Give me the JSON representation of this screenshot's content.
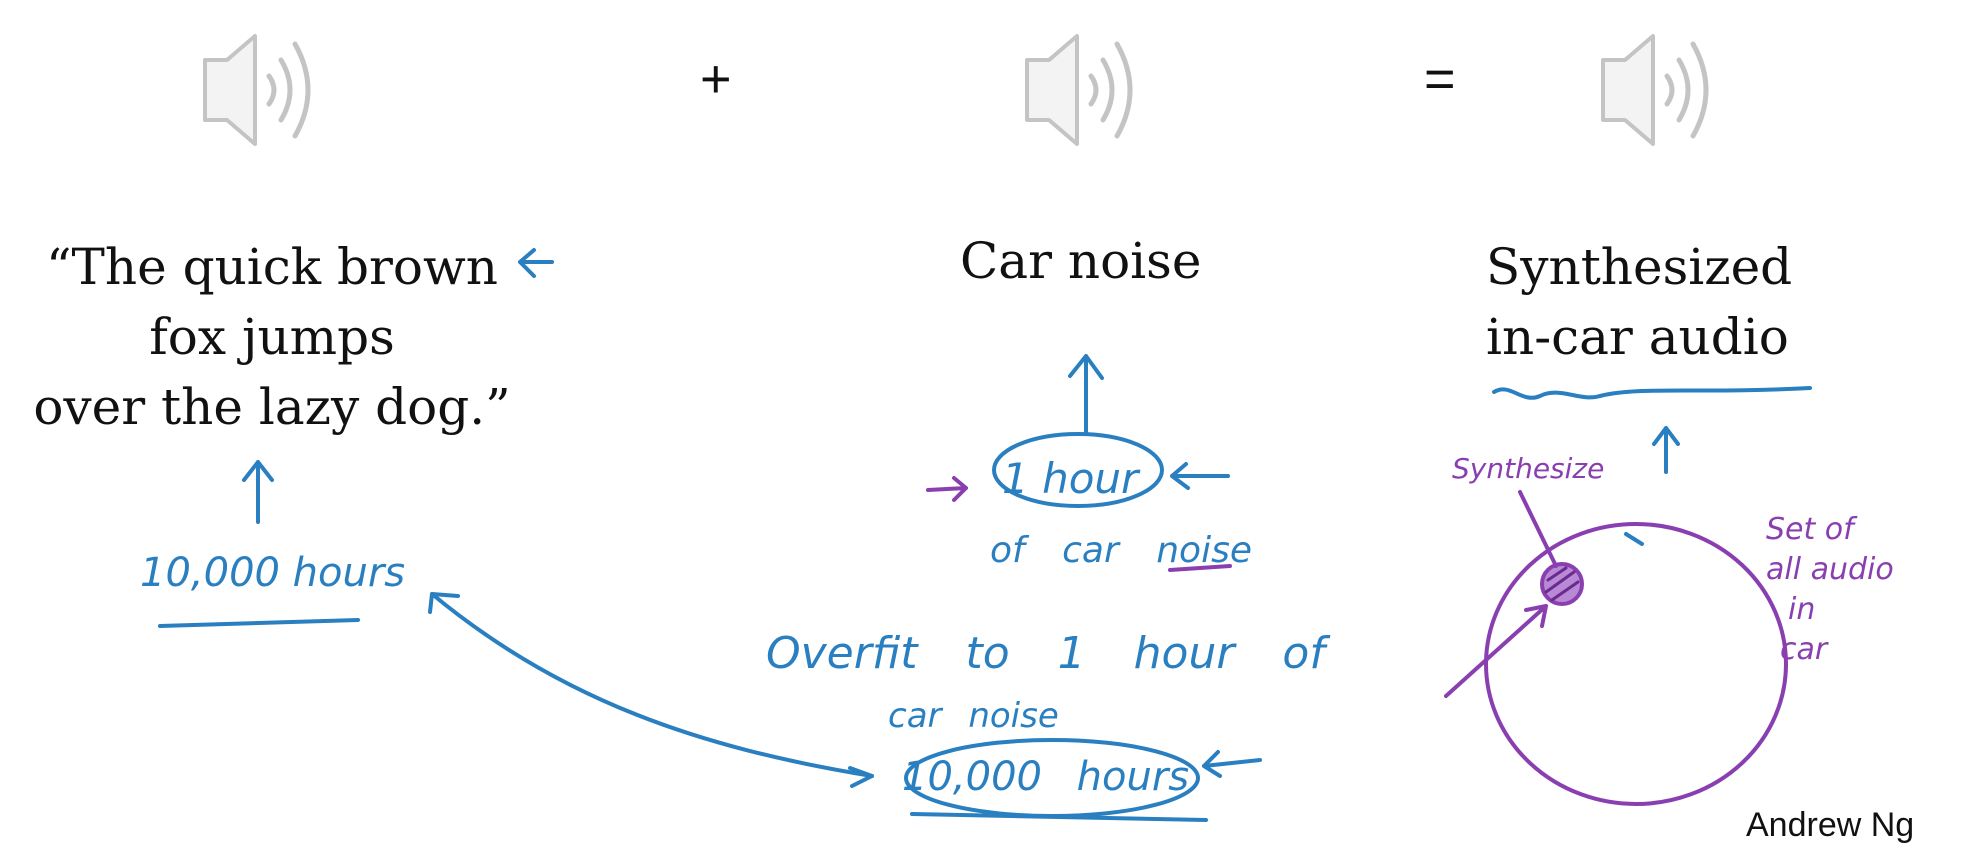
{
  "equation": {
    "plus": "+",
    "equals": "="
  },
  "left": {
    "quote_lines": [
      "“The quick brown",
      "fox jumps",
      "over the lazy dog.”"
    ],
    "hours_note": "10,000 hours"
  },
  "middle": {
    "title": "Car noise",
    "hour_note": "1 hour",
    "of_car_noise": "of car noise",
    "overfit_line1": "Overfit to 1 hour of",
    "overfit_line2": "car noise",
    "hours_note": "10,000 hours"
  },
  "right": {
    "title_lines": [
      "Synthesized",
      "in-car audio"
    ],
    "synthesize_note": "Synthesize",
    "set_note_lines": [
      "Set of",
      "all audio",
      "in",
      "car"
    ]
  },
  "credit": "Andrew Ng",
  "icons": [
    "speaker-icon",
    "speaker-icon",
    "speaker-icon"
  ],
  "colors": {
    "text": "#111111",
    "blue_ink": "#2a7fc0",
    "purple_ink": "#8a3fb0",
    "icon_gray": "#c9c9c9"
  }
}
